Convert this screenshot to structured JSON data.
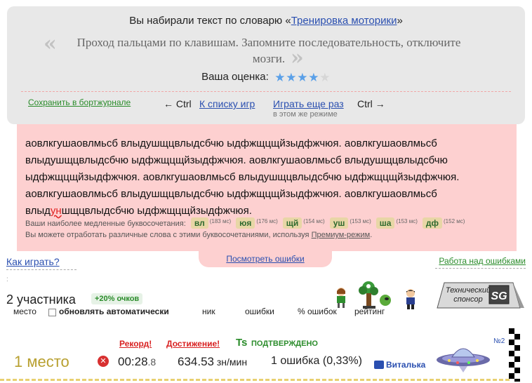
{
  "summary": {
    "headline_prefix": "Вы набирали текст по словарю «",
    "dictionary_name": "Тренировка моторики",
    "headline_suffix": "»",
    "quote_open": "«",
    "quote_close": "»",
    "quote_text": "Проход пальцами по клавишам. Запомните последовательность, отключите мозги.",
    "rating_label": "Ваша оценка:",
    "rating_value": 4,
    "rating_max": 5,
    "star_color": "#5aa0e8",
    "save_link": "Сохранить в бортжурнале",
    "ctrl_left": "← Ctrl",
    "games_list_link": "К списку игр",
    "play_again_link": "Играть еще раз",
    "play_again_sub": "в этом же режиме",
    "ctrl_right": "Ctrl →"
  },
  "typed": {
    "before_typo": "аовлкгушаовлмьсб влыдушщцвлыдсбчю ыдфжщцщйзыдфжчюя. аовлкгушаовлмьсб влыдушщцвлыдсбчю ыдфжщцщйзыдфжчюя. аовлкгушаовлмьсб влыдушщцвлыдсбчю ыдфжщцщйзыдфжчюя. аовлкгушаовлмьсб влыдушщцвлыдсбчю ыдфжщцщйзыдфжчюя. аовлкгушаовлмьсб влыдушщцвлыдсбчю ыдфжщцщйзыдфжчюя. аовлкгушаовлмьсб влыд",
    "typo": "ун",
    "after_typo": "шщцвлыдсбчю ыдфжщцщйзыдфжчюя.",
    "slow_label": "Ваши наиболее медленные буквосочетания:",
    "slow_combos": [
      {
        "combo": "вл",
        "time": "(183 мс)"
      },
      {
        "combo": "юя",
        "time": "(176 мс)"
      },
      {
        "combo": "щй",
        "time": "(154 мс)"
      },
      {
        "combo": "уш",
        "time": "(153 мс)"
      },
      {
        "combo": "ша",
        "time": "(153 мс)"
      },
      {
        "combo": "дф",
        "time": "(152 мс)"
      }
    ],
    "practice_prefix": "Вы можете отработать различные слова с этими буквосочетаниями, используя ",
    "practice_link": "Премиум-режим",
    "practice_suffix": "."
  },
  "links": {
    "show_errors": "Посмотреть ошибки",
    "how_to_play": "Как играть?",
    "work_on_errors": "Работа над ошибками"
  },
  "players": {
    "dots": ":",
    "count": "2 участника",
    "bonus": "+20% очков",
    "col_place": "место",
    "autoupdate": "обновлять автоматически",
    "col_nick": "ник",
    "col_errors": "ошибки",
    "col_error_pct": "% ошибок",
    "col_rating": "рейтинг",
    "sponsor_line1": "Технический",
    "sponsor_line2": "спонсор",
    "sponsor_logo": "SG"
  },
  "result": {
    "place": "1 место",
    "record": "Рекорд!",
    "achievement": "Достижение!",
    "ts_badge": "Ts",
    "verified": "ПОДТВЕРЖДЕНО",
    "error_icon": "✕",
    "time_main": "00:28",
    "time_frac": ".8",
    "speed": "634.53",
    "speed_unit": " зн/мин",
    "errors": "1 ошибка",
    "error_pct": " (0,33%)",
    "username": "Виталька",
    "car_number": "№2"
  }
}
